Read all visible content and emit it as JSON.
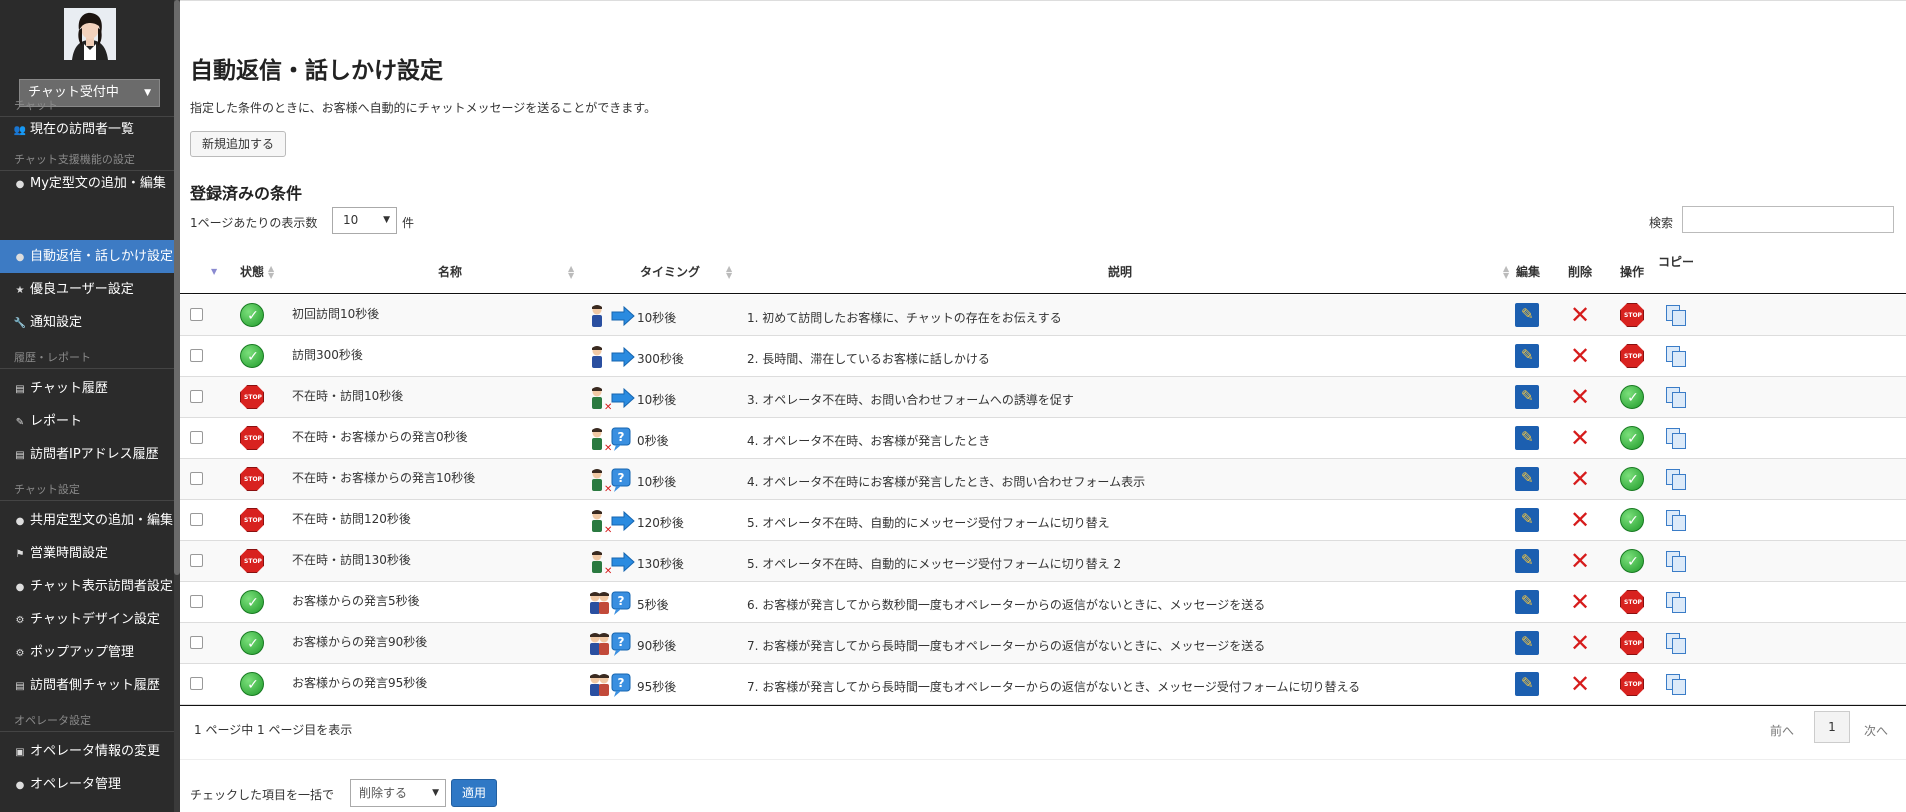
{
  "sidebar": {
    "status_select": "チャット受付中",
    "sections": [
      {
        "title": "チャット",
        "items": [
          {
            "label": "現在の訪問者一覧",
            "icon": "users-icon"
          }
        ]
      },
      {
        "title": "チャット支援機能の設定",
        "items": [
          {
            "label": "My定型文の追加・編集",
            "icon": "speech-bubble-icon"
          },
          {
            "label": "自動返信・話しかけ設定",
            "icon": "speech-bubble-icon",
            "active": true
          },
          {
            "label": "優良ユーザー設定",
            "icon": "star-icon"
          },
          {
            "label": "通知設定",
            "icon": "wrench-icon"
          }
        ]
      },
      {
        "title": "履歴・レポート",
        "items": [
          {
            "label": "チャット履歴",
            "icon": "list-icon"
          },
          {
            "label": "レポート",
            "icon": "pencil-icon"
          },
          {
            "label": "訪問者IPアドレス履歴",
            "icon": "list-icon"
          }
        ]
      },
      {
        "title": "チャット設定",
        "items": [
          {
            "label": "共用定型文の追加・編集",
            "icon": "speech-bubble-icon"
          },
          {
            "label": "営業時間設定",
            "icon": "flag-icon"
          },
          {
            "label": "チャット表示訪問者設定",
            "icon": "user-icon"
          },
          {
            "label": "チャットデザイン設定",
            "icon": "gear-icon"
          },
          {
            "label": "ポップアップ管理",
            "icon": "gear-icon"
          },
          {
            "label": "訪問者側チャット履歴",
            "icon": "list-icon"
          }
        ]
      },
      {
        "title": "オペレータ設定",
        "items": [
          {
            "label": "オペレータ情報の変更",
            "icon": "id-card-icon"
          },
          {
            "label": "オペレータ管理",
            "icon": "user-icon"
          }
        ]
      }
    ]
  },
  "main": {
    "title": "自動返信・話しかけ設定",
    "description": "指定した条件のときに、お客様へ自動的にチャットメッセージを送ることができます。",
    "add_button": "新規追加する",
    "subtitle": "登録済みの条件",
    "per_page_label": "1ページあたりの表示数",
    "per_page_value": "10",
    "per_page_unit": "件",
    "search_label": "検索",
    "columns": {
      "status": "状態",
      "name": "名称",
      "timing": "タイミング",
      "description": "説明",
      "edit": "編集",
      "delete": "削除",
      "operation": "操作",
      "copy": "コピー"
    },
    "rows": [
      {
        "status": "on",
        "name": "初回訪問10秒後",
        "timing_type": "visit",
        "timing": "10秒後",
        "description": "1. 初めて訪問したお客様に、チャットの存在をお伝えする",
        "op": "stop"
      },
      {
        "status": "on",
        "name": "訪問300秒後",
        "timing_type": "visit",
        "timing": "300秒後",
        "description": "2. 長時間、滞在しているお客様に話しかける",
        "op": "stop"
      },
      {
        "status": "off",
        "name": "不在時・訪問10秒後",
        "timing_type": "absent-visit",
        "timing": "10秒後",
        "description": "3. オペレータ不在時、お問い合わせフォームへの誘導を促す",
        "op": "start"
      },
      {
        "status": "off",
        "name": "不在時・お客様からの発言0秒後",
        "timing_type": "absent-message",
        "timing": "0秒後",
        "description": "4. オペレータ不在時、お客様が発言したとき",
        "op": "start"
      },
      {
        "status": "off",
        "name": "不在時・お客様からの発言10秒後",
        "timing_type": "absent-message",
        "timing": "10秒後",
        "description": "4. オペレータ不在時にお客様が発言したとき、お問い合わせフォーム表示",
        "op": "start"
      },
      {
        "status": "off",
        "name": "不在時・訪問120秒後",
        "timing_type": "absent-visit",
        "timing": "120秒後",
        "description": "5. オペレータ不在時、自動的にメッセージ受付フォームに切り替え",
        "op": "start"
      },
      {
        "status": "off",
        "name": "不在時・訪問130秒後",
        "timing_type": "absent-visit",
        "timing": "130秒後",
        "description": "5. オペレータ不在時、自動的にメッセージ受付フォームに切り替え 2",
        "op": "start"
      },
      {
        "status": "on",
        "name": "お客様からの発言5秒後",
        "timing_type": "customer-message",
        "timing": "5秒後",
        "description": "6. お客様が発言してから数秒間一度もオペレーターからの返信がないときに、メッセージを送る",
        "op": "stop"
      },
      {
        "status": "on",
        "name": "お客様からの発言90秒後",
        "timing_type": "customer-message",
        "timing": "90秒後",
        "description": "7. お客様が発言してから長時間一度もオペレーターからの返信がないときに、メッセージを送る",
        "op": "stop"
      },
      {
        "status": "on",
        "name": "お客様からの発言95秒後",
        "timing_type": "customer-message",
        "timing": "95秒後",
        "description": "7. お客様が発言してから長時間一度もオペレーターからの返信がないとき、メッセージ受付フォームに切り替える",
        "op": "stop"
      }
    ],
    "page_info": "1 ページ中 1 ページ目を表示",
    "pagination": {
      "prev": "前へ",
      "current": "1",
      "next": "次へ"
    },
    "bulk": {
      "label": "チェックした項目を一括で",
      "select": "削除する",
      "apply": "適用"
    },
    "status_icon_text": {
      "on": "✓",
      "off": "STOP"
    },
    "colors": {
      "accent": "#3d7bc4",
      "sidebar_bg": "#2b2b2b",
      "on": "#1f9a2a",
      "stop": "#d8221f"
    }
  }
}
